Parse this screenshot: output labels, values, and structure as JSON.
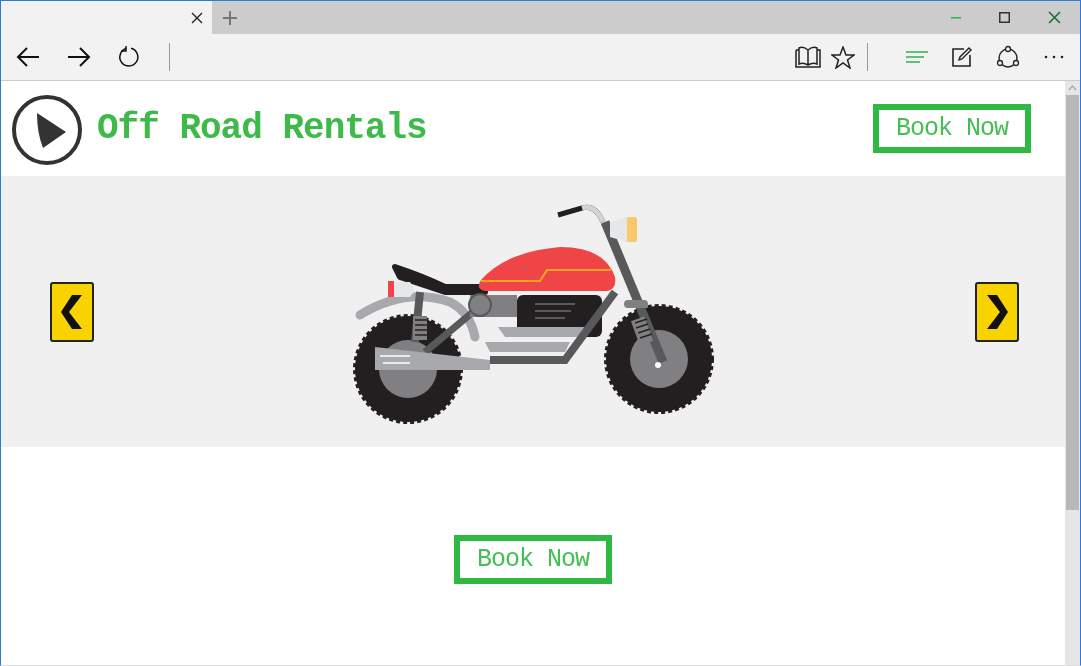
{
  "browser": {
    "tabs": [
      {
        "selected": true
      }
    ]
  },
  "site": {
    "title": "Off Road Rentals",
    "header_button": "Book Now"
  },
  "cta_button": "Book Now"
}
